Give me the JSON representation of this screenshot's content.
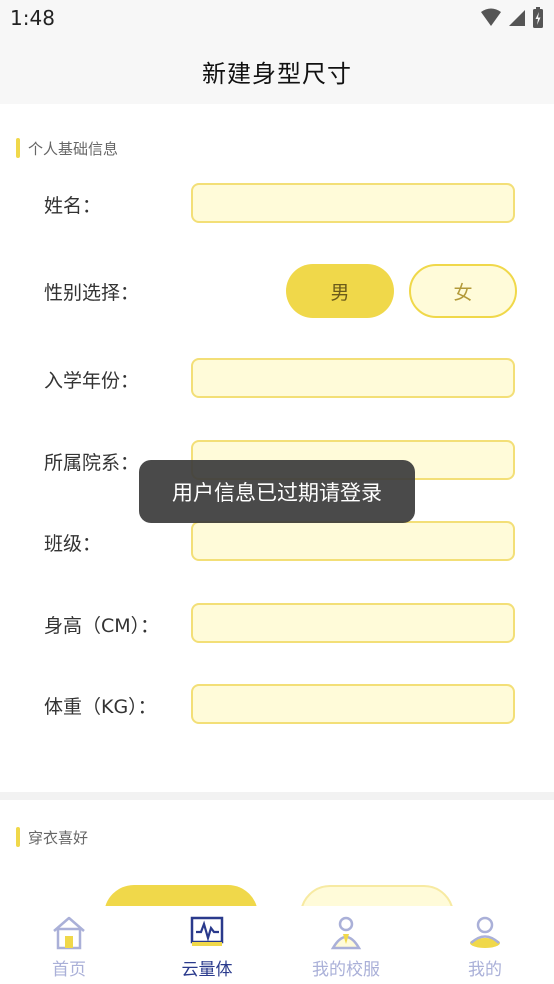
{
  "status_bar": {
    "time": "1:48"
  },
  "header": {
    "title": "新建身型尺寸"
  },
  "basic_info": {
    "section_title": "个人基础信息",
    "name_label": "姓名：",
    "gender_label": "性别选择：",
    "gender_male": "男",
    "gender_female": "女",
    "enroll_year_label": "入学年份：",
    "department_label": "所属院系：",
    "class_label": "班级：",
    "height_label": "身高（CM）：",
    "weight_label": "体重（KG）："
  },
  "preferences": {
    "section_title": "穿衣喜好"
  },
  "toast": {
    "message": "用户信息已过期请登录"
  },
  "tabbar": {
    "items": [
      {
        "label": "首页",
        "icon": "home-icon",
        "active": false
      },
      {
        "label": "云量体",
        "icon": "measure-monitor-icon",
        "active": true
      },
      {
        "label": "我的校服",
        "icon": "uniform-person-icon",
        "active": false
      },
      {
        "label": "我的",
        "icon": "profile-icon",
        "active": false
      }
    ]
  },
  "colors": {
    "accent": "#f0d84a",
    "input_bg": "#fffbd9",
    "active_tab": "#2a3a8c",
    "inactive_tab": "#aab0d8"
  }
}
